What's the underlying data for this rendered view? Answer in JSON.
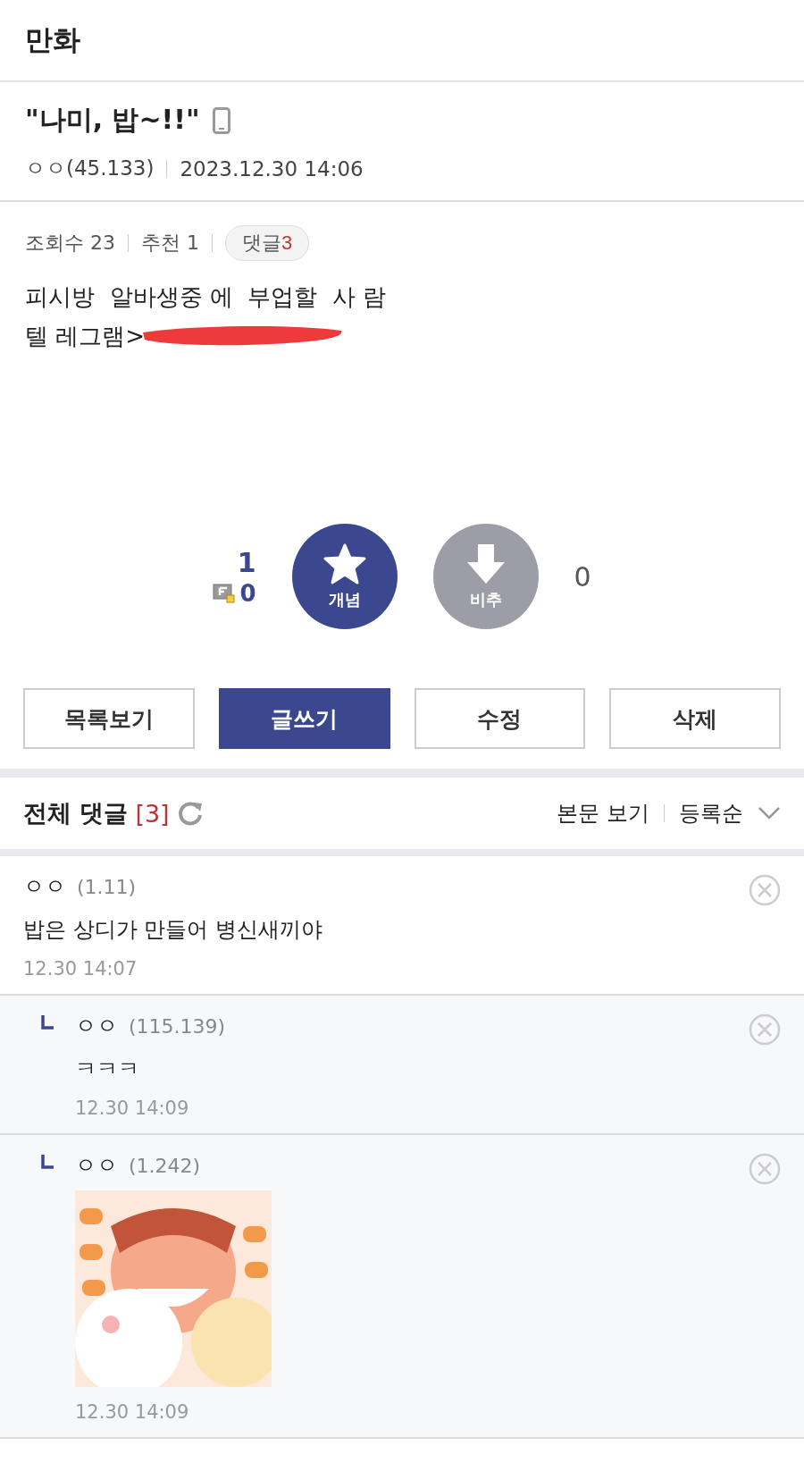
{
  "header": {
    "title": "만화"
  },
  "post": {
    "title": "\"나미, 밥~!!\"",
    "mobile": true,
    "author": "ㅇㅇ(45.133)",
    "date": "2023.12.30 14:06",
    "views": "조회수 23",
    "recommends": "추천 1",
    "comment_badge": {
      "label": "댓글",
      "count": "3"
    },
    "body_lines": [
      "피시방  알바생중 에  부업할  사 람",
      "텔 레그램>"
    ],
    "redacted": true
  },
  "votes": {
    "up_count": "1",
    "fixed_count": "0",
    "up_label": "개념",
    "down_label": "비추",
    "down_count": "0"
  },
  "buttons": [
    {
      "label": "목록보기",
      "primary": false
    },
    {
      "label": "글쓰기",
      "primary": true
    },
    {
      "label": "수정",
      "primary": false
    },
    {
      "label": "삭제",
      "primary": false
    }
  ],
  "comments_header": {
    "title": "전체 댓글",
    "count": "[3]",
    "view_body": "본문 보기",
    "sort": "등록순"
  },
  "comments": [
    {
      "kind": "comment",
      "name": "ㅇㅇ",
      "ip": "(1.11)",
      "text": "밥은 상디가 만들어 병신새끼야",
      "time": "12.30 14:07"
    },
    {
      "kind": "reply",
      "name": "ㅇㅇ",
      "ip": "(115.139)",
      "text": "ㅋㅋㅋ",
      "time": "12.30 14:09"
    },
    {
      "kind": "reply",
      "name": "ㅇㅇ",
      "ip": "(1.242)",
      "time": "12.30 14:09"
    }
  ]
}
